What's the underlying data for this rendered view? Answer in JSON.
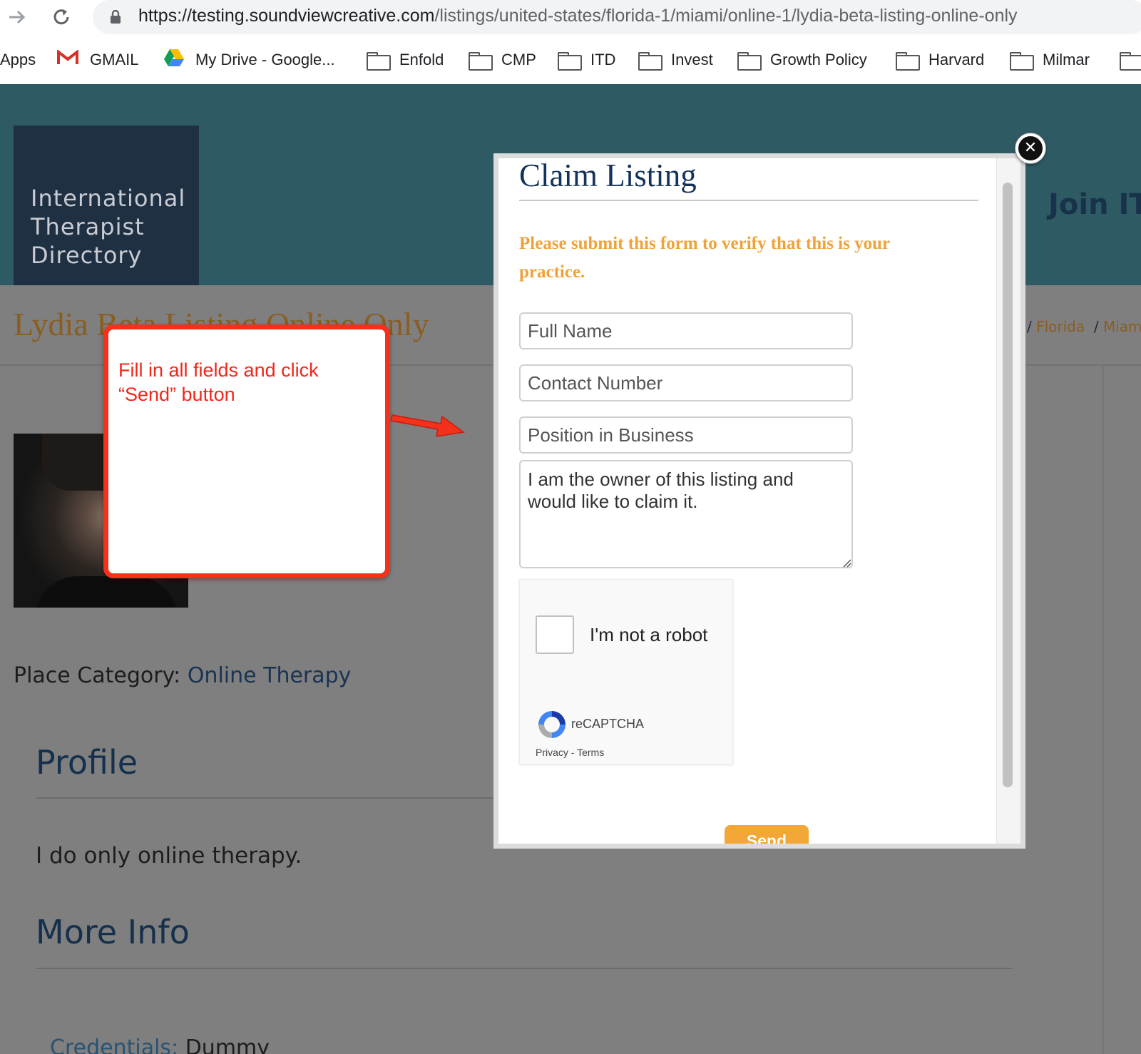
{
  "browser": {
    "url_host": "https://testing.soundviewcreative.com",
    "url_path": "/listings/united-states/florida-1/miami/online-1/lydia-beta-listing-online-only",
    "bookmarks": [
      "Apps",
      "GMAIL",
      "My Drive - Google...",
      "Enfold",
      "CMP",
      "ITD",
      "Invest",
      "Growth Policy",
      "Harvard",
      "Milmar"
    ]
  },
  "site": {
    "logo_lines": [
      "International",
      "Therapist",
      "Directory"
    ],
    "join_label": "Join ITD",
    "listing_title": "Lydia Beta Listing Online Only",
    "breadcrumb": [
      "Florida",
      "Miami"
    ],
    "place_category_label": "Place Category:",
    "place_category_value": "Online Therapy",
    "profile_heading": "Profile",
    "profile_text": "I do only online therapy.",
    "more_info_heading": "More Info",
    "credentials_label": "Credentials:",
    "credentials_value": "Dummy"
  },
  "callout": {
    "text": "Fill in all fields and click “Send” button",
    "color": "#f5301b"
  },
  "modal": {
    "title": "Claim Listing",
    "intro": "Please submit this form to verify that this is your practice.",
    "full_name_placeholder": "Full Name",
    "contact_placeholder": "Contact Number",
    "position_placeholder": "Position in Business",
    "message_value": "I am the owner of this listing and would like to claim it.",
    "captcha_label": "I'm not a robot",
    "captcha_brand": "reCAPTCHA",
    "captcha_links": "Privacy - Terms",
    "send_label": "Send",
    "close_symbol": "✕",
    "accent_color": "#f2a737"
  }
}
